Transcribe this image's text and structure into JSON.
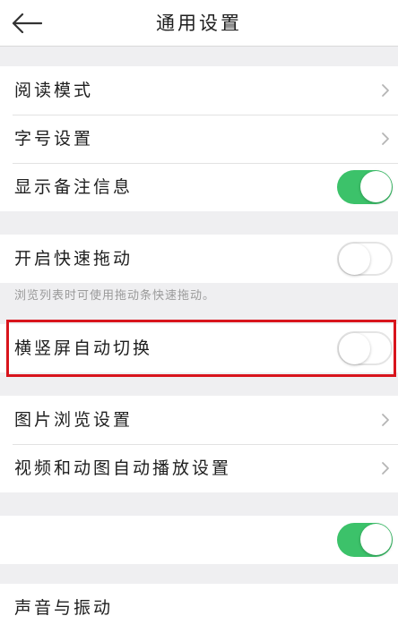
{
  "header": {
    "title": "通用设置"
  },
  "sections": {
    "reading": {
      "reading_mode": "阅读模式",
      "font_size": "字号设置",
      "show_notes": "显示备注信息",
      "show_notes_state": "on"
    },
    "scroll": {
      "fast_drag": "开启快速拖动",
      "fast_drag_state": "off",
      "fast_drag_hint": "浏览列表时可使用拖动条快速拖动。"
    },
    "rotate": {
      "auto_rotate": "横竖屏自动切换",
      "auto_rotate_state": "off"
    },
    "media": {
      "image_browse": "图片浏览设置",
      "video_autoplay": "视频和动图自动播放设置"
    },
    "misc": {
      "unnamed_toggle_state": "on"
    },
    "sound": {
      "sound_vibration": "声音与振动"
    }
  },
  "colors": {
    "toggle_on": "#3cc26a",
    "highlight": "#d8141c",
    "background": "#efeff1"
  },
  "icons": {
    "back": "arrow-left-icon",
    "chevron": "chevron-right-icon"
  }
}
